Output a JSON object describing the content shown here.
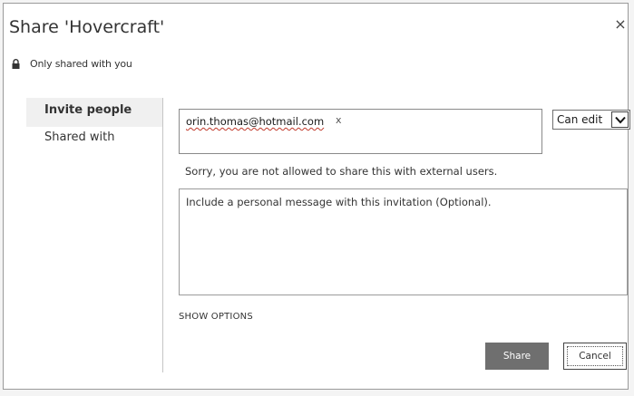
{
  "dialog": {
    "title": "Share 'Hovercraft'",
    "close_glyph": "×",
    "status": {
      "icon": "lock-icon",
      "text": "Only shared with you"
    }
  },
  "nav": {
    "items": [
      {
        "label": "Invite people",
        "active": true
      },
      {
        "label": "Shared with",
        "active": false
      }
    ]
  },
  "invite": {
    "recipients": [
      {
        "email": "orin.thomas@hotmail.com",
        "remove_glyph": "x"
      }
    ],
    "permission": {
      "selected": "Can edit",
      "icon": "chevron-down-icon"
    },
    "error_message": "Sorry, you are not allowed to share this with external users.",
    "message_placeholder": "Include a personal message with this invitation (Optional).",
    "show_options_label": "SHOW OPTIONS"
  },
  "actions": {
    "share_label": "Share",
    "cancel_label": "Cancel"
  },
  "colors": {
    "share_button": "#6f6f6f",
    "nav_active_bg": "#f0f0f0",
    "error_underline": "#c0392b"
  }
}
